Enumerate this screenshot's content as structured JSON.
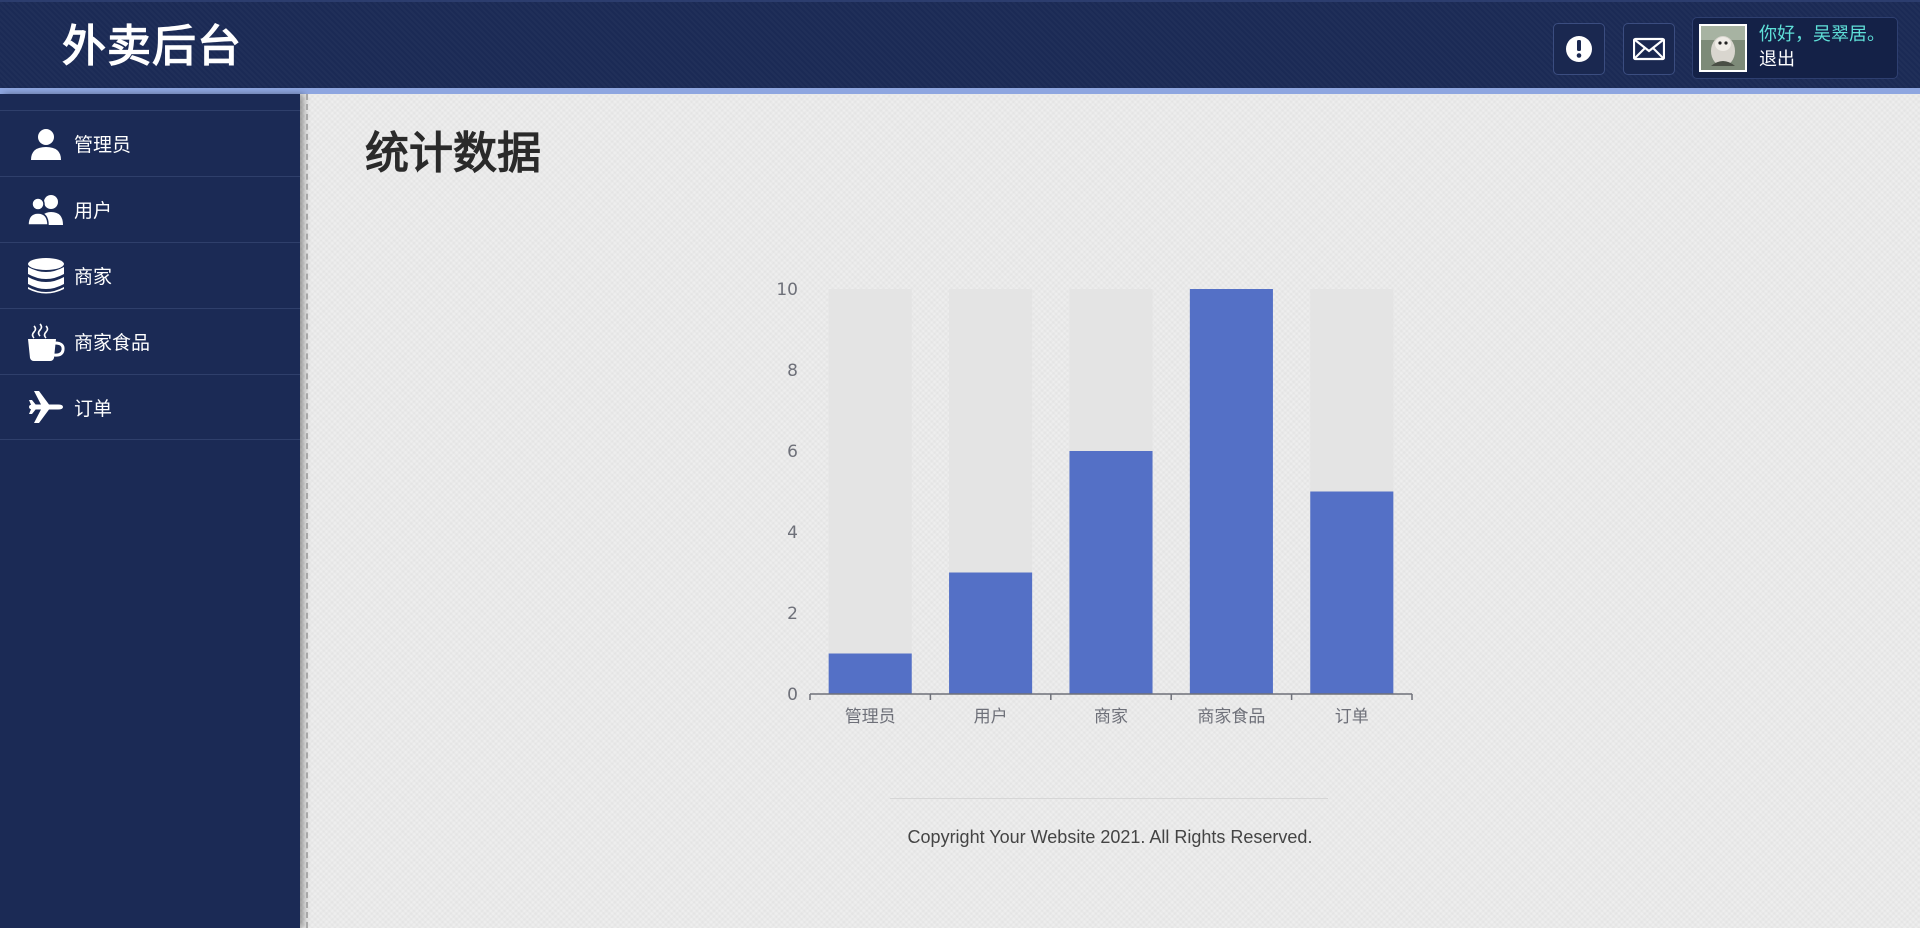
{
  "header": {
    "brand": "外卖后台",
    "alert_icon": "alert-icon",
    "mail_icon": "mail-icon",
    "user": {
      "greeting": "你好，吴翠居。",
      "logout": "退出"
    }
  },
  "sidebar": {
    "items": [
      {
        "label": "管理员",
        "icon": "admin-user-icon"
      },
      {
        "label": "用户",
        "icon": "users-icon"
      },
      {
        "label": "商家",
        "icon": "database-icon"
      },
      {
        "label": "商家食品",
        "icon": "coffee-cup-icon"
      },
      {
        "label": "订单",
        "icon": "airplane-icon"
      }
    ]
  },
  "main": {
    "title": "统计数据"
  },
  "chart_data": {
    "type": "bar",
    "categories": [
      "管理员",
      "用户",
      "商家",
      "商家食品",
      "订单"
    ],
    "values": [
      1,
      3,
      6,
      10,
      5
    ],
    "ylim": [
      0,
      10
    ],
    "yticks": [
      "0",
      "2",
      "4",
      "6",
      "8",
      "10"
    ],
    "background_bars": true,
    "grid": false,
    "colors": {
      "bar": "#5470c6",
      "background_bar": "#e4e4e4"
    }
  },
  "footer": {
    "text": "Copyright Your Website 2021. All Rights Reserved."
  },
  "colors": {
    "header_bg": "#1b2a55",
    "accent_stripe": "#8ea6e0",
    "greeting": "#5fe0d8"
  }
}
